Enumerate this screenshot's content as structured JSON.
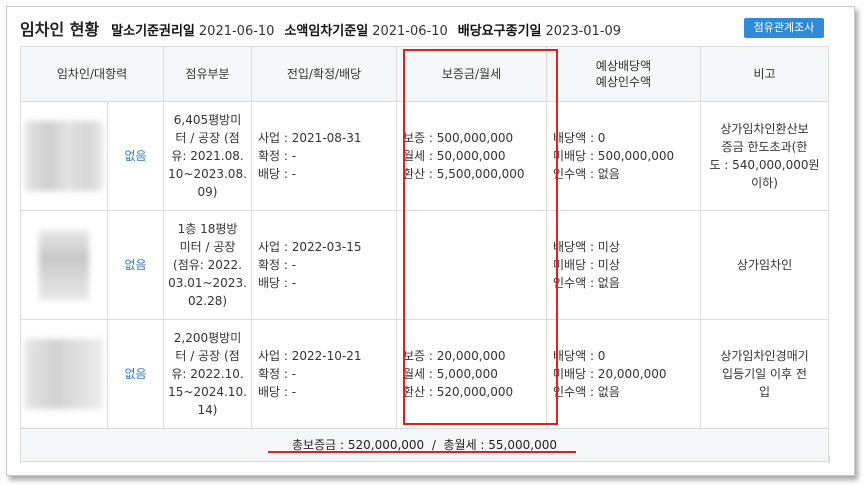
{
  "header": {
    "title": "임차인 현황",
    "items": [
      {
        "label": "말소기준권리일",
        "value": "2021-06-10"
      },
      {
        "label": "소액임차기준일",
        "value": "2021-06-10"
      },
      {
        "label": "배당요구종기일",
        "value": "2023-01-09"
      }
    ],
    "survey_button": "점유관계조사"
  },
  "columns": [
    "임차인/대항력",
    "점유부분",
    "전입/확정/배당",
    "보증금/월세",
    "예상배당액",
    "예상인수액",
    "비고"
  ],
  "rows": [
    {
      "opposition": "없음",
      "occupancy": [
        "6,405평방미",
        "터 / 공장 (점",
        "유: 2021.08.",
        "10~2023.08.",
        "09)"
      ],
      "move": [
        "사업 : 2021-08-31",
        "확정 : -",
        "배당 : -"
      ],
      "deposit": [
        "보증 : 500,000,000",
        "월세 : 50,000,000",
        "환산 : 5,500,000,000"
      ],
      "dividend": [
        "배당액 : 0",
        "미배당 : 500,000,000",
        "인수액 : 없음"
      ],
      "note": [
        "상가임차인환산보",
        "증금 한도초과(한",
        "도 : 540,000,000원",
        "이하)"
      ]
    },
    {
      "opposition": "없음",
      "occupancy": [
        "1층 18평방",
        "미터 / 공장",
        "(점유: 2022.",
        "03.01~2023.",
        "02.28)"
      ],
      "move": [
        "사업 : 2022-03-15",
        "확정 : -",
        "배당 : -"
      ],
      "deposit": [],
      "dividend": [
        "배당액 : 미상",
        "미배당 : 미상",
        "인수액 : 없음"
      ],
      "note": [
        "상가임차인"
      ]
    },
    {
      "opposition": "없음",
      "occupancy": [
        "2,200평방미",
        "터 / 공장 (점",
        "유: 2022.10.",
        "15~2024.10.",
        "14)"
      ],
      "move": [
        "사업 : 2022-10-21",
        "확정 : -",
        "배당 : -"
      ],
      "deposit": [
        "보증 : 20,000,000",
        "월세 : 5,000,000",
        "환산 : 520,000,000"
      ],
      "dividend": [
        "배당액 : 0",
        "미배당 : 20,000,000",
        "인수액 : 없음"
      ],
      "note": [
        "상가임차인경매기",
        "입등기일 이후 전",
        "입"
      ]
    }
  ],
  "total": "총보증금 : 520,000,000  /  총월세 : 55,000,000",
  "colors": {
    "accent_button": "#2f8ad8",
    "highlight": "#e02020",
    "link": "#2f79c9",
    "header_bg": "#f5f7f9"
  }
}
